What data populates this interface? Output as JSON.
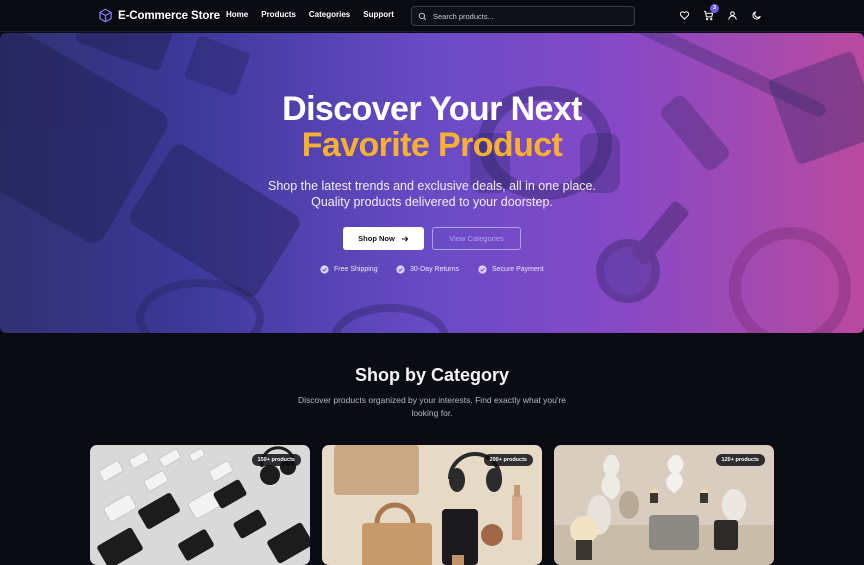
{
  "brand": {
    "name": "E-Commerce Store",
    "logo_icon": "cube-icon",
    "accent": "#7c6cf6"
  },
  "nav": {
    "links": [
      "Home",
      "Products",
      "Categories",
      "Support"
    ],
    "search_placeholder": "Search products...",
    "icons": [
      "heart-icon",
      "cart-icon",
      "user-icon",
      "moon-icon"
    ],
    "cart_count": "3"
  },
  "hero": {
    "title_line1": "Discover Your Next",
    "title_line2": "Favorite Product",
    "subtitle_line1": "Shop the latest trends and exclusive deals, all in one place.",
    "subtitle_line2": "Quality products delivered to your doorstep.",
    "primary_button": "Shop Now",
    "secondary_button": "View Categories",
    "perks": [
      "Free Shipping",
      "30-Day Returns",
      "Secure Payment"
    ],
    "title_accent_color": "#f8b12e"
  },
  "categories": {
    "title": "Shop by Category",
    "description_line1": "Discover products organized by your interests. Find exactly what you're",
    "description_line2": "looking for.",
    "cards": [
      {
        "badge": "150+ products"
      },
      {
        "badge": "200+ products"
      },
      {
        "badge": "120+ products"
      }
    ]
  }
}
